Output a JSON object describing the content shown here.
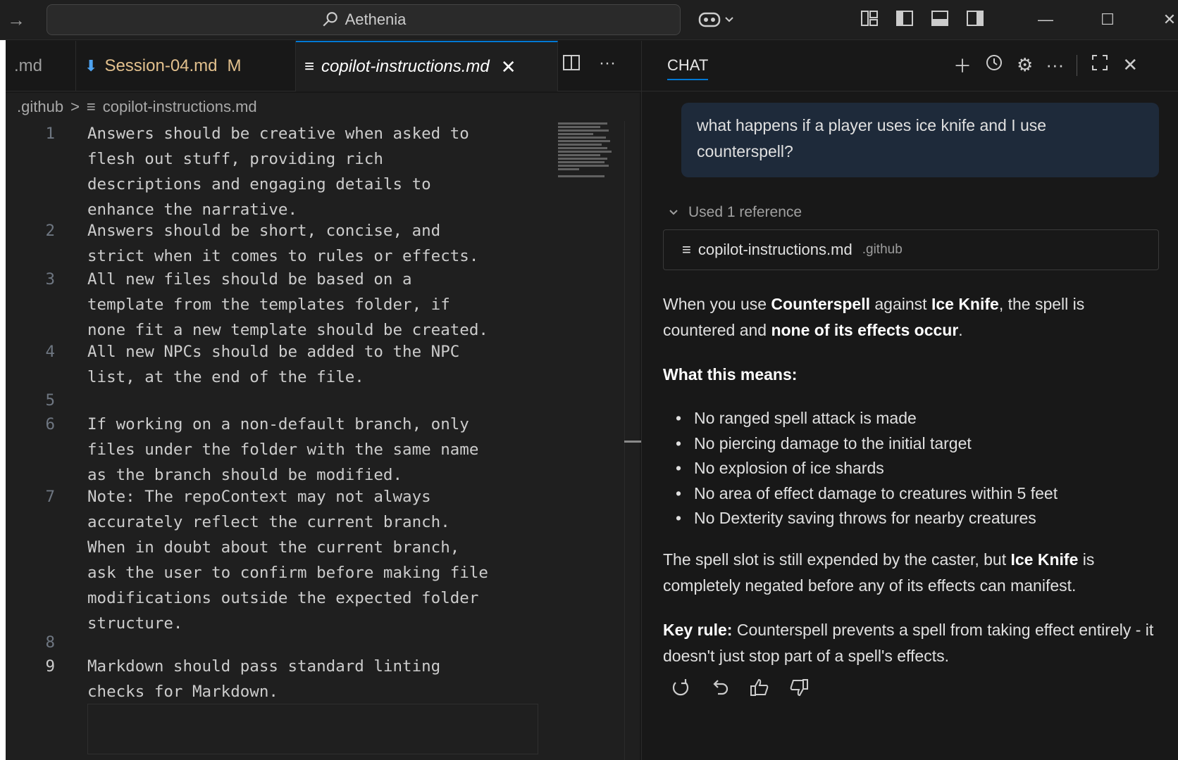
{
  "titlebar": {
    "search_text": "Aethenia"
  },
  "tabs": [
    {
      "label": ".md"
    },
    {
      "label": "Session-04.md",
      "badge": "M"
    },
    {
      "label": "copilot-instructions.md"
    }
  ],
  "breadcrumb": {
    "folder": ".github",
    "file": "copilot-instructions.md"
  },
  "editor": {
    "lines": [
      {
        "n": "1",
        "text": "Answers should be creative when asked to\nflesh out stuff, providing rich\ndescriptions and engaging details to\nenhance the narrative."
      },
      {
        "n": "2",
        "text": "Answers should be short, concise, and\nstrict when it comes to rules or effects."
      },
      {
        "n": "3",
        "text": "All new files should be based on a\ntemplate from the templates folder, if\nnone fit a new template should be created."
      },
      {
        "n": "4",
        "text": "All new NPCs should be added to the NPC\nlist, at the end of the file."
      },
      {
        "n": "5",
        "text": ""
      },
      {
        "n": "6",
        "text": "If working on a non-default branch, only\nfiles under the folder with the same name\nas the branch should be modified."
      },
      {
        "n": "7",
        "text": "Note: The repoContext may not always\naccurately reflect the current branch.\nWhen in doubt about the current branch,\nask the user to confirm before making file\nmodifications outside the expected folder\nstructure."
      },
      {
        "n": "8",
        "text": ""
      },
      {
        "n": "9",
        "text": "Markdown should pass standard linting\nchecks for Markdown."
      }
    ]
  },
  "chat": {
    "tab_label": "CHAT",
    "user_message": "what happens if a player uses ice knife and I use counterspell?",
    "references_label": "Used 1 reference",
    "reference_file": "copilot-instructions.md",
    "reference_dir": ".github",
    "answer": {
      "p1_a": "When you use ",
      "p1_b": "Counterspell",
      "p1_c": " against ",
      "p1_d": "Ice Knife",
      "p1_e": ", the spell is countered and ",
      "p1_f": "none of its effects occur",
      "p1_g": ".",
      "heading": "What this means:",
      "bullets": [
        "No ranged spell attack is made",
        "No piercing damage to the initial target",
        "No explosion of ice shards",
        "No area of effect damage to creatures within 5 feet",
        "No Dexterity saving throws for nearby creatures"
      ],
      "p2_a": "The spell slot is still expended by the caster, but ",
      "p2_b": "Ice Knife",
      "p2_c": " is completely negated before any of its effects can manifest.",
      "p3_a": "Key rule:",
      "p3_b": " Counterspell prevents a spell from taking effect entirely - it doesn't just stop part of a spell's effects."
    }
  }
}
